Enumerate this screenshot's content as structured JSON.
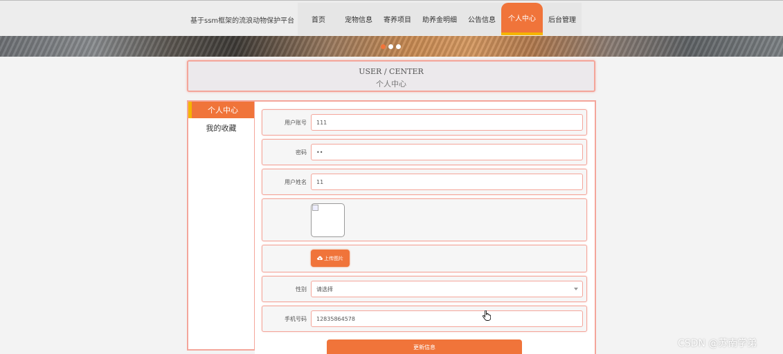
{
  "header": {
    "site_title": "基于ssm框架的流浪动物保护平台",
    "nav": [
      {
        "label": "首页"
      },
      {
        "label": "宠物信息"
      },
      {
        "label": "寄养项目"
      },
      {
        "label": "助养金明细"
      },
      {
        "label": "公告信息"
      },
      {
        "label": "个人中心",
        "active": true
      },
      {
        "label": "后台管理"
      }
    ]
  },
  "banner": {
    "slide_count": 3,
    "active_slide": 1
  },
  "page_title": {
    "en": "USER / CENTER",
    "cn": "个人中心"
  },
  "sidebar": {
    "items": [
      {
        "label": "个人中心",
        "active": true
      },
      {
        "label": "我的收藏"
      }
    ]
  },
  "form": {
    "username": {
      "label": "用户账号",
      "value": "111"
    },
    "password": {
      "label": "密码",
      "value": "••"
    },
    "name": {
      "label": "用户姓名",
      "value": "11"
    },
    "upload_button": "上传图片",
    "gender": {
      "label": "性别",
      "value": "请选择"
    },
    "phone": {
      "label": "手机号码",
      "value": "12835864578"
    },
    "submit": "更新信息"
  },
  "watermark": "CSDN @苏南学弟",
  "colors": {
    "accent": "#f0743a",
    "highlight": "#f5b400",
    "border": "#f4a59a"
  }
}
